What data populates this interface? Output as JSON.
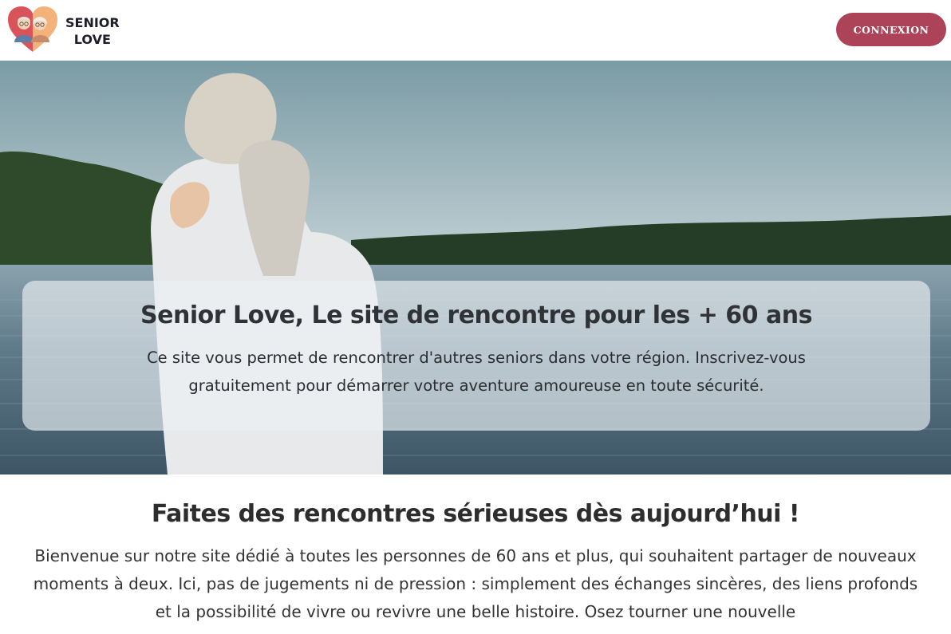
{
  "brand": {
    "line1": "SENIOR",
    "line2": "LOVE",
    "logo_icon": "couple-heart-icon",
    "heart_color_left": "#d8545a",
    "heart_color_right": "#f3b27a"
  },
  "header": {
    "login_label": "CONNEXION",
    "login_color": "#ad4358"
  },
  "hero": {
    "image": "elderly-couple-lake-photo",
    "title": "Senior Love, Le site de rencontre pour les + 60 ans",
    "text": "Ce site vous permet de rencontrer d'autres seniors dans votre région. Inscrivez-vous gratuitement pour démarrer votre aventure amoureuse en toute sécurité."
  },
  "intro": {
    "title": "Faites des rencontres sérieuses dès aujourd’hui !",
    "text": "Bienvenue sur notre site dédié à toutes les personnes de 60 ans et plus, qui souhaitent partager de nouveaux moments à deux. Ici, pas de jugements ni de pression : simplement des échanges sincères, des liens profonds et la possibilité de vivre ou revivre une belle histoire. Osez tourner une nouvelle"
  }
}
